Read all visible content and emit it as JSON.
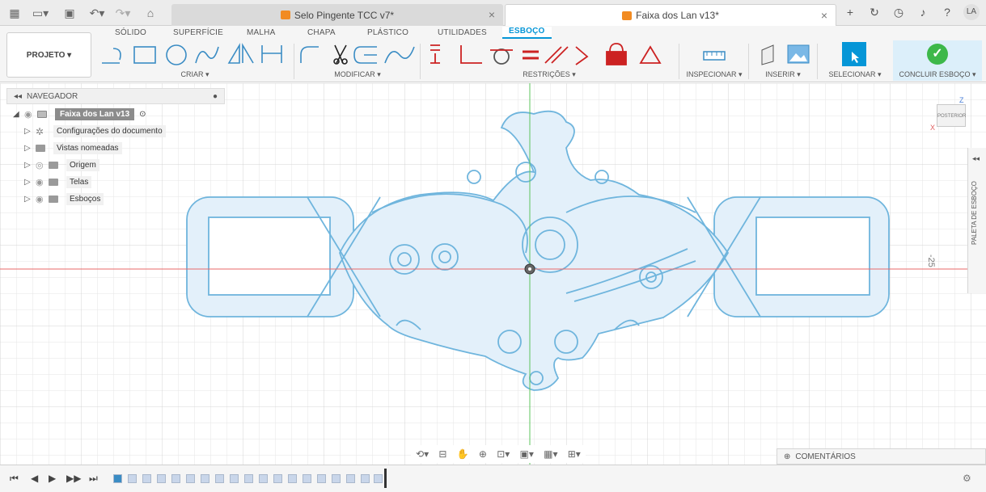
{
  "titlebar": {
    "tabs": [
      {
        "label": "Selo Pingente TCC v7*",
        "active": false
      },
      {
        "label": "Faixa dos Lan v13*",
        "active": true
      }
    ],
    "close_glyph": "×",
    "add_glyph": "+",
    "user_initials": "LA"
  },
  "toolbar": {
    "project_label": "PROJETO ▾",
    "workspace_tabs": [
      "SÓLIDO",
      "SUPERFÍCIE",
      "MALHA",
      "CHAPA",
      "PLÁSTICO",
      "UTILIDADES",
      "ESBOÇO"
    ],
    "active_tab": "ESBOÇO",
    "groups": {
      "criar": "CRIAR ▾",
      "modificar": "MODIFICAR ▾",
      "restricoes": "RESTRIÇÕES ▾",
      "inspecionar": "INSPECIONAR ▾",
      "inserir": "INSERIR ▾",
      "selecionar": "SELECIONAR ▾",
      "concluir": "CONCLUIR ESBOÇO ▾"
    }
  },
  "navigator": {
    "header": "NAVEGADOR",
    "root": "Faixa dos Lan v13",
    "items": [
      {
        "label": "Configurações do documento",
        "icon": "gear-icon"
      },
      {
        "label": "Vistas nomeadas",
        "icon": "folder-icon"
      },
      {
        "label": "Origem",
        "icon": "folder-icon"
      },
      {
        "label": "Telas",
        "icon": "folder-icon"
      },
      {
        "label": "Esboços",
        "icon": "folder-icon"
      }
    ]
  },
  "canvas": {
    "viewcube_label": "POSTERIOR",
    "axis_z": "Z",
    "axis_x": "X",
    "dimension": "-25",
    "palette_label": "PALETA DE ESBOÇO",
    "comments_label": "COMENTÁRIOS"
  },
  "colors": {
    "accent": "#0696d7",
    "sketch_stroke": "#6fb5dd",
    "sketch_fill": "#e3f0fa",
    "x_axis": "#e86a6a",
    "y_axis": "#5cc55c",
    "confirm": "#3db84a"
  }
}
